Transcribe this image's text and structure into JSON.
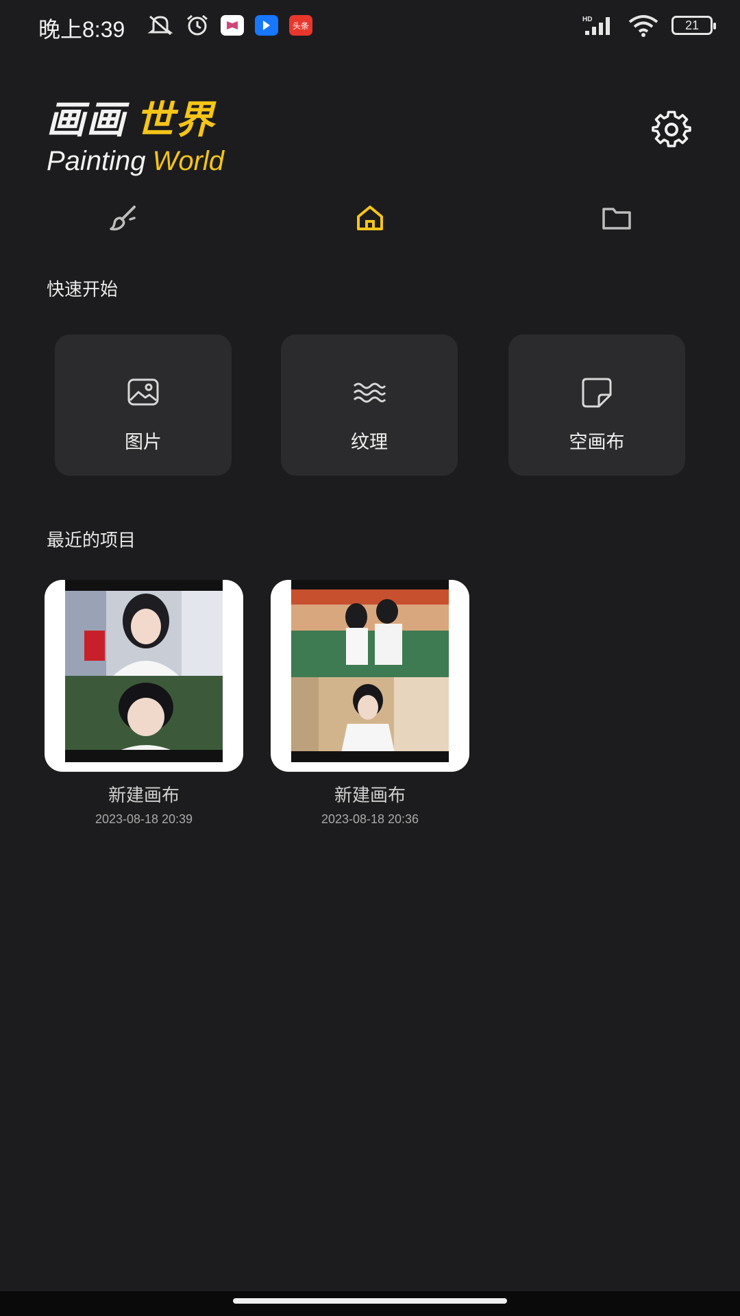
{
  "status_bar": {
    "time": "晚上8:39",
    "battery": "21",
    "icons": [
      "mute-icon",
      "alarm-icon",
      "app-icon",
      "app-icon",
      "news-app-icon",
      "signal-icon",
      "wifi-icon",
      "battery-icon"
    ],
    "news_badge": "头条"
  },
  "logo": {
    "cn_white": "画画",
    "cn_yellow": "世界",
    "en_white": "Painting",
    "en_yellow": "World",
    "accent_color": "#f5c518"
  },
  "tabs": [
    {
      "icon": "brush-icon",
      "active": false
    },
    {
      "icon": "home-icon",
      "active": true
    },
    {
      "icon": "folder-icon",
      "active": false
    }
  ],
  "quick_start": {
    "title": "快速开始",
    "items": [
      {
        "label": "图片",
        "icon": "image-icon"
      },
      {
        "label": "纹理",
        "icon": "texture-icon"
      },
      {
        "label": "空画布",
        "icon": "blank-canvas-icon"
      }
    ]
  },
  "recent": {
    "title": "最近的项目",
    "projects": [
      {
        "name": "新建画布",
        "date": "2023-08-18 20:39"
      },
      {
        "name": "新建画布",
        "date": "2023-08-18 20:36"
      }
    ]
  }
}
